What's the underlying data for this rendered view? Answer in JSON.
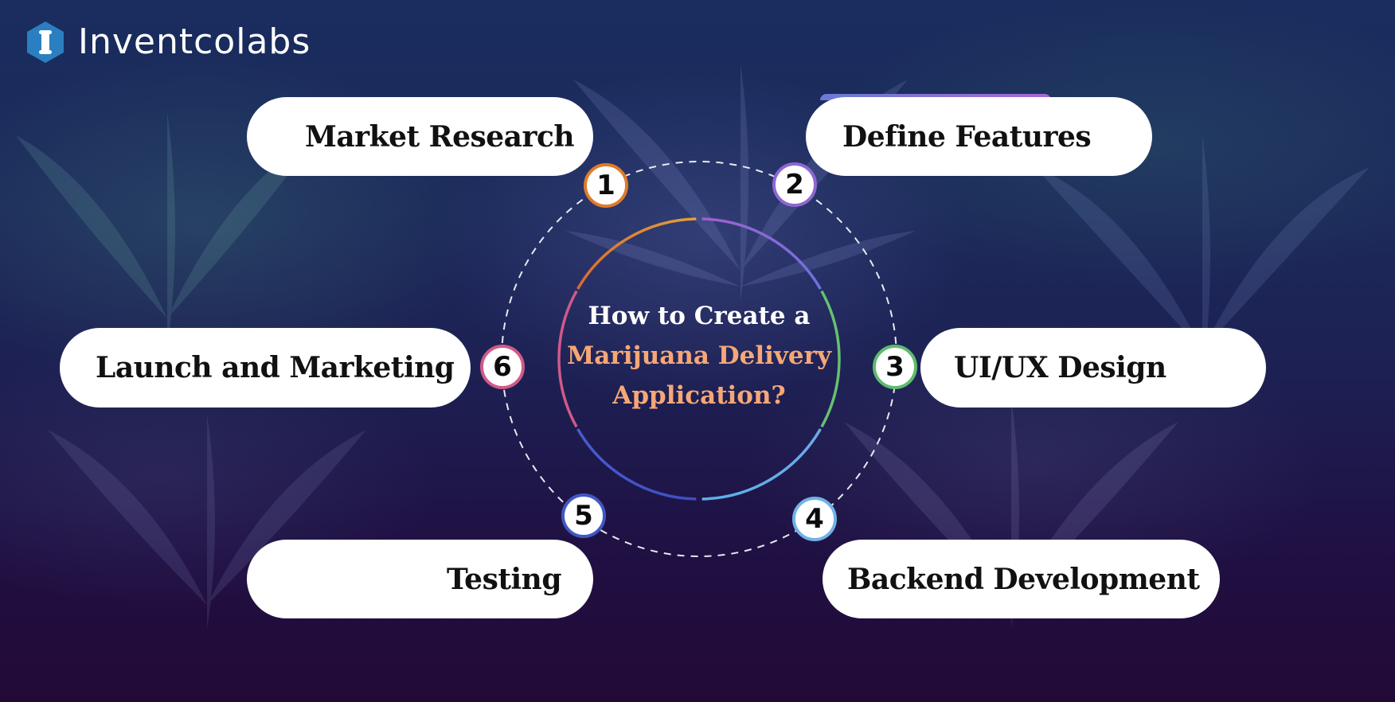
{
  "brand": {
    "logo_letter": "I",
    "name": "Inventcolabs",
    "logo_color": "#2a7fc1"
  },
  "center": {
    "line1": "How to Create a",
    "line2": "Marijuana Delivery",
    "line3": "Application?",
    "line1_color": "#ffffff",
    "highlight_color": "#f6a777"
  },
  "steps": [
    {
      "number": "1",
      "label": "Market Research",
      "color": "#e07a2a"
    },
    {
      "number": "2",
      "label": "Define Features",
      "color": "#8f67d1"
    },
    {
      "number": "3",
      "label": "UI/UX Design",
      "color": "#5dbb6f"
    },
    {
      "number": "4",
      "label": "Backend Development",
      "color": "#6fb2e8"
    },
    {
      "number": "5",
      "label": "Testing",
      "color": "#4057c4"
    },
    {
      "number": "6",
      "label": "Launch and Marketing",
      "color": "#d05a87"
    }
  ],
  "inner_ring_colors": {
    "segment_top_left": [
      "#e2a03a",
      "#d96a2e"
    ],
    "segment_top_right": [
      "#6c72dc",
      "#a35fd0"
    ],
    "segment_right": "#66c070",
    "segment_bottom_right": [
      "#5ab1ea",
      "#6ea8e8"
    ],
    "segment_bottom_left": [
      "#4a5bd0",
      "#3e4fc2"
    ],
    "segment_left": "#d05a87"
  }
}
